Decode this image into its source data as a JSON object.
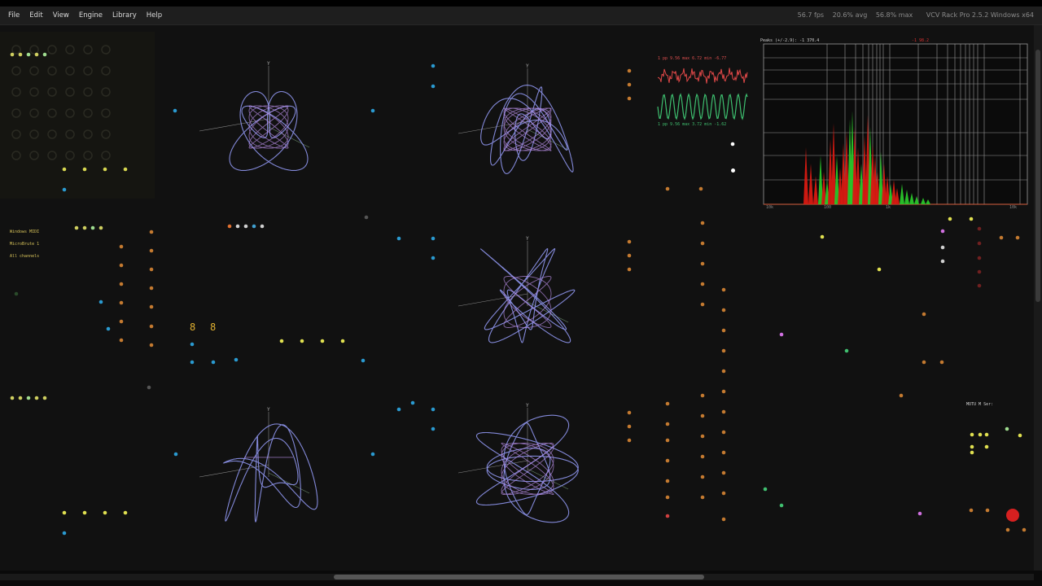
{
  "menu": {
    "items": [
      {
        "label": "File"
      },
      {
        "label": "Edit"
      },
      {
        "label": "View"
      },
      {
        "label": "Engine"
      },
      {
        "label": "Library"
      },
      {
        "label": "Help"
      }
    ]
  },
  "status": {
    "fps": "56.7 fps",
    "avg": "20.6% avg",
    "max": "56.8% max",
    "version": "VCV Rack Pro 2.5.2 Windows x64"
  },
  "midi_module": {
    "driver": "Windows MIDI",
    "device": "MicroBrute 1",
    "channel": "All channels"
  },
  "segment_display": {
    "left": "8",
    "right": "8"
  },
  "scope_readout": {
    "top": "1 pp   9.56 max   6.72 min -6.77",
    "bottom": "1 pp   9.56 max   3.72 min -1.62"
  },
  "analyzer": {
    "peak_label": "Peaks (+/-2.9): -1   370.4",
    "peak_label_2": "-1   98.2",
    "x_ticks": [
      "10k",
      "100",
      "1k",
      "10k"
    ]
  },
  "interface_module": {
    "label": "MOTU M Ser:"
  },
  "colors": {
    "background": "#111111",
    "menubar": "#1e1e1e",
    "trace": "#8f96ee",
    "trace_alt": "#b98fe8",
    "scope_red": "#e04848",
    "scope_green": "#3ec070",
    "analyzer_red": "#d81a12",
    "analyzer_green": "#2ac62a",
    "jack_orange": "#c47a30",
    "jack_blue": "#2a9ad0",
    "record": "#d62020"
  },
  "icons": {
    "record": "record-button-icon",
    "cursor": "mouse-cursor-icon"
  }
}
